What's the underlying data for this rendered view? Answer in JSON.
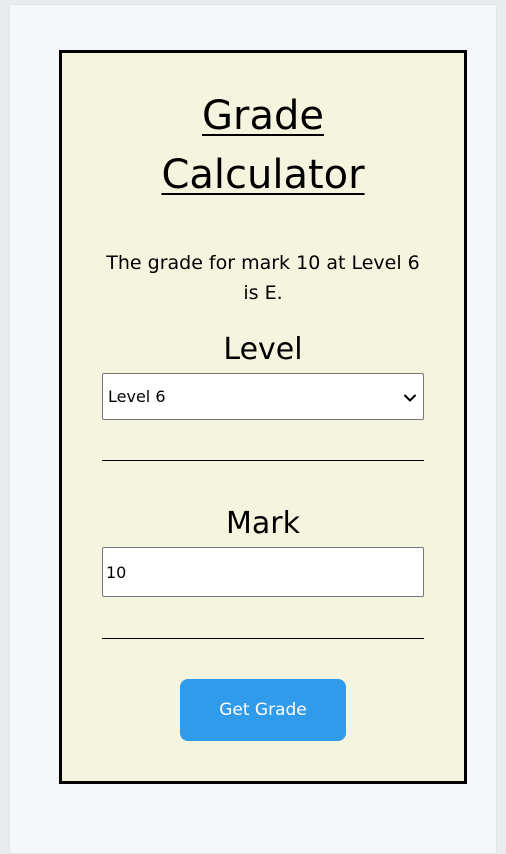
{
  "calculator": {
    "title_line1": "Grade",
    "title_line2": "Calculator",
    "result_text": "The grade for mark 10 at Level 6 is E.",
    "level_label": "Level",
    "level_selected": "Level 6",
    "mark_label": "Mark",
    "mark_value": "10",
    "button_label": "Get Grade"
  },
  "colors": {
    "page_background": "#f6f7fb",
    "card_background": "#f4f4df",
    "card_border": "#000000",
    "button_background": "#2f9bea",
    "button_text": "#ffffff"
  },
  "icons": {
    "select_arrow": "chevron-down-icon"
  }
}
